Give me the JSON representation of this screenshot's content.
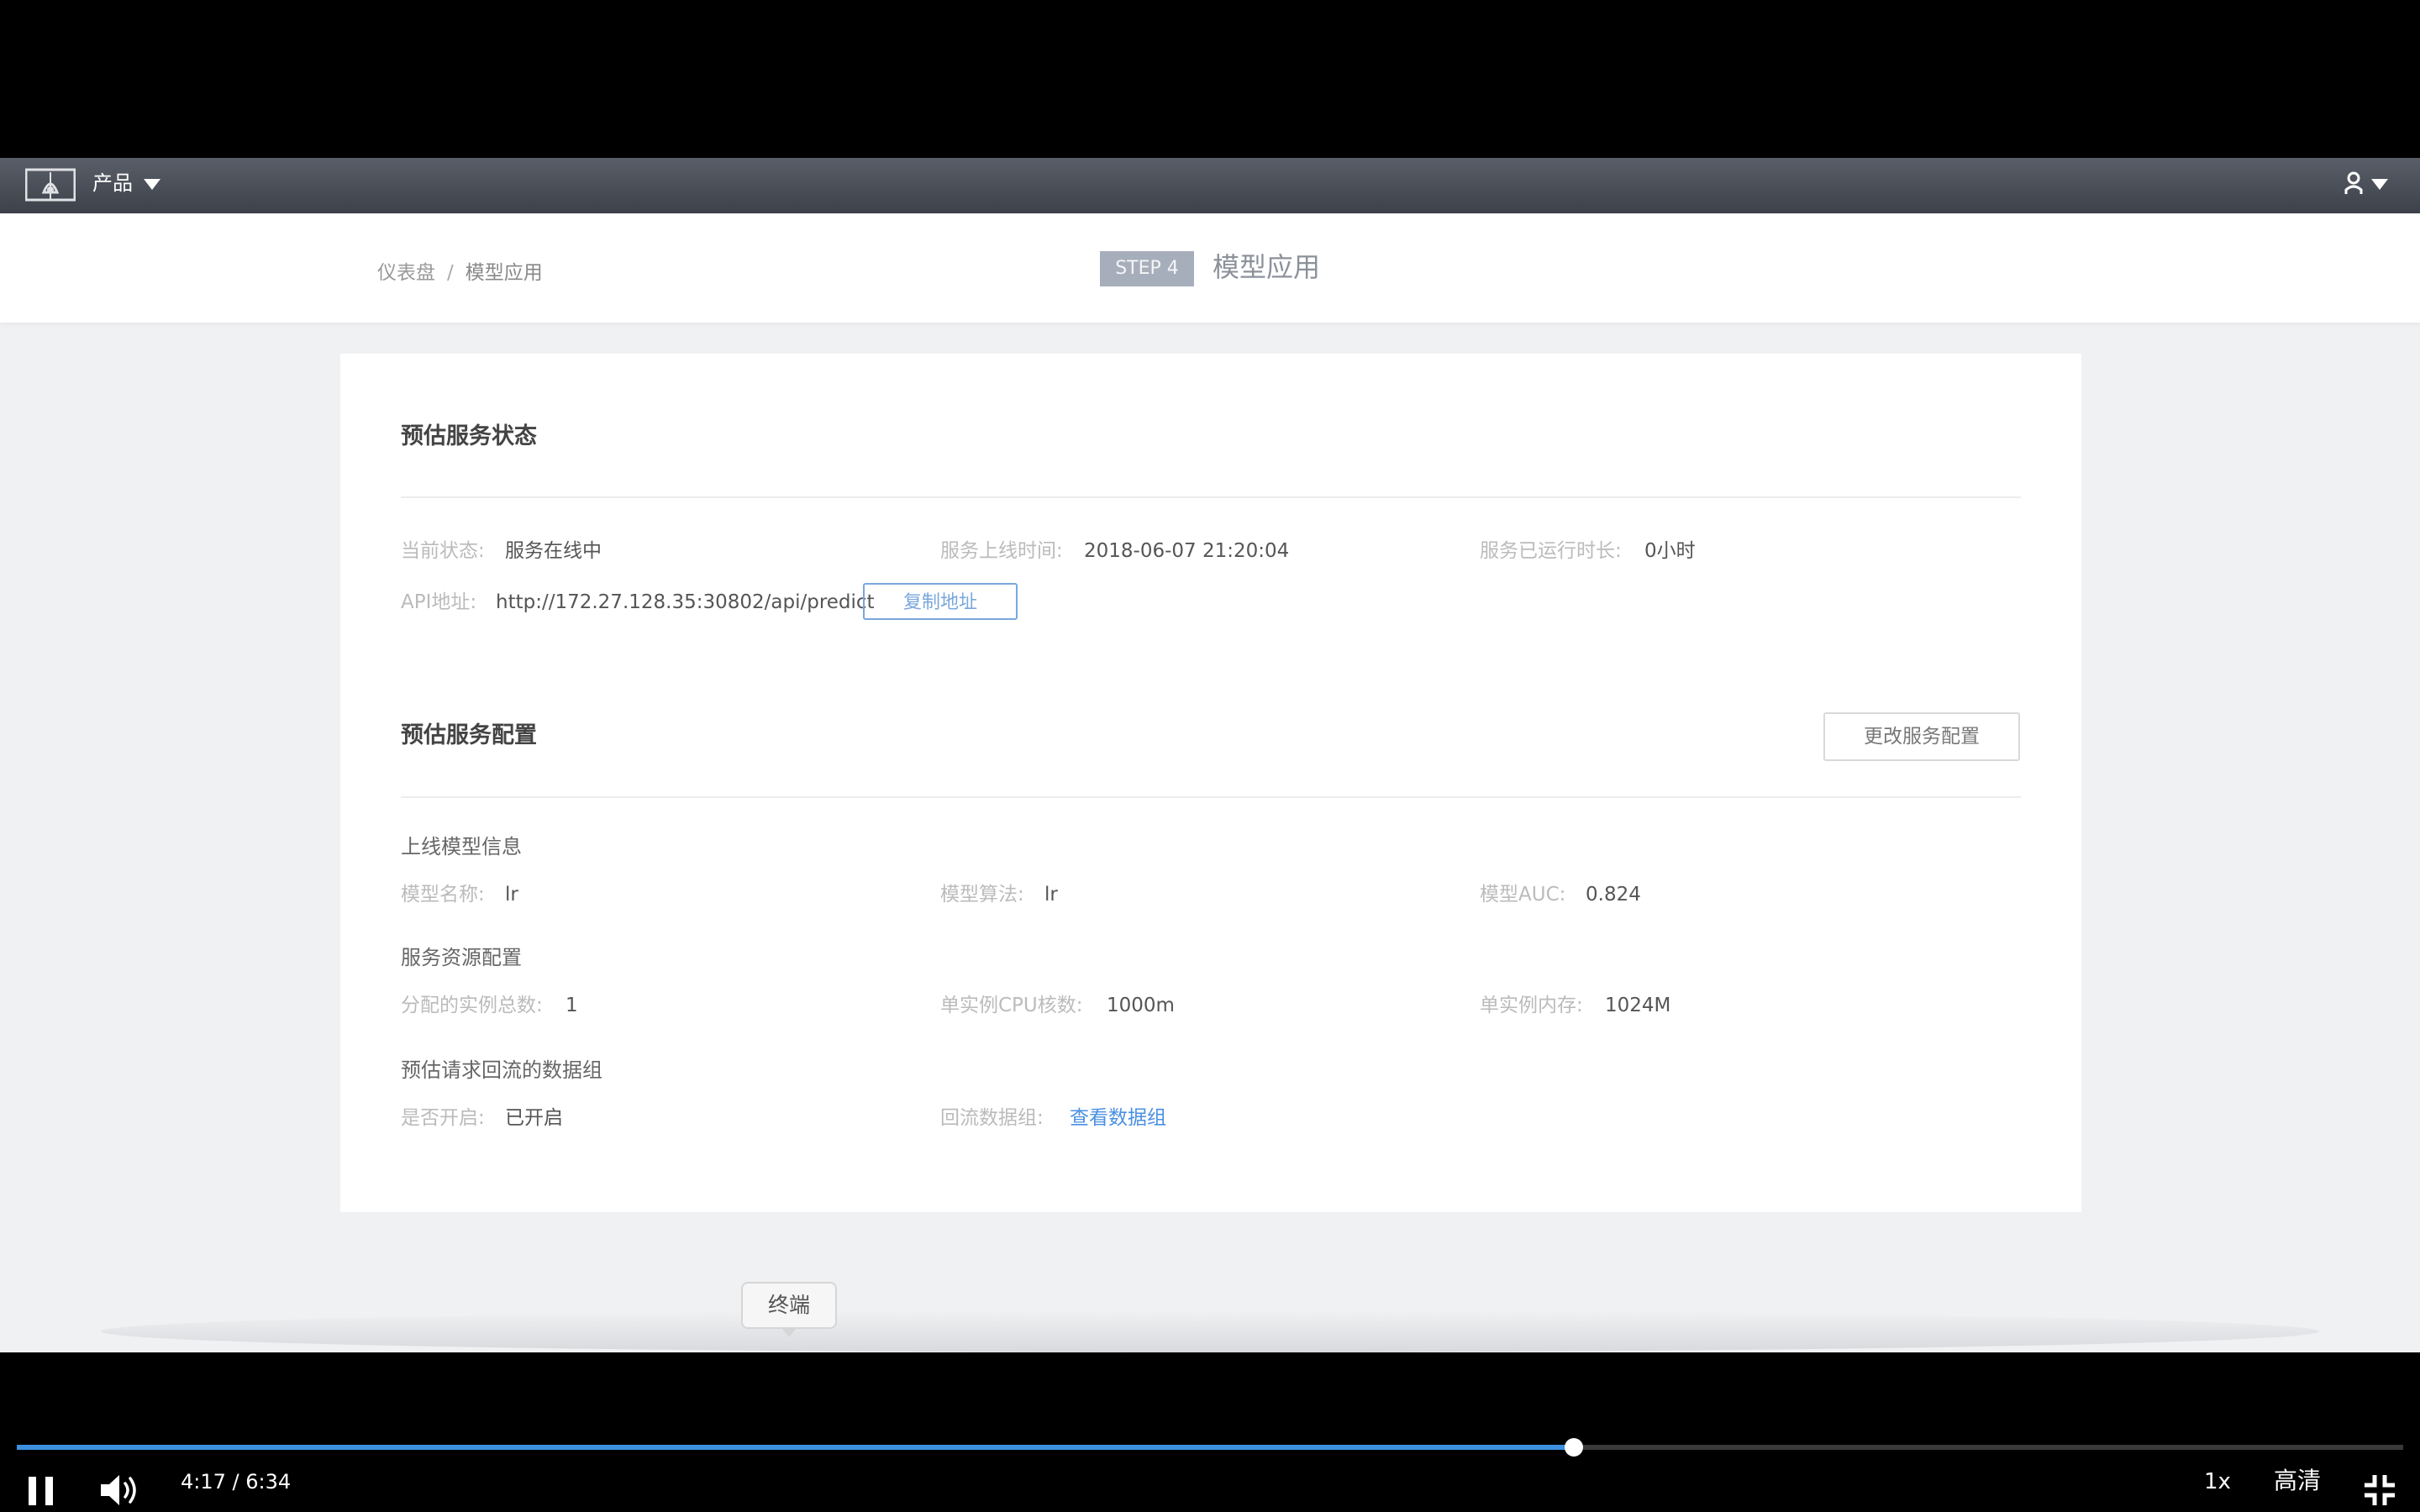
{
  "nav": {
    "product_label": "产品"
  },
  "breadcrumb": {
    "root": "仪表盘",
    "separator": "/",
    "current": "模型应用"
  },
  "step": {
    "badge": "STEP 4",
    "title": "模型应用"
  },
  "status_section": {
    "title": "预估服务状态",
    "current_status_label": "当前状态:",
    "current_status_value": "服务在线中",
    "online_time_label": "服务上线时间:",
    "online_time_value": "2018-06-07 21:20:04",
    "runtime_label": "服务已运行时长:",
    "runtime_value": "0小时",
    "api_label": "API地址:",
    "api_value": "http://172.27.128.35:30802/api/predict",
    "copy_button": "复制地址"
  },
  "config_section": {
    "title": "预估服务配置",
    "change_button": "更改服务配置",
    "model_info": {
      "title": "上线模型信息",
      "name_label": "模型名称:",
      "name_value": "lr",
      "algo_label": "模型算法:",
      "algo_value": "lr",
      "auc_label": "模型AUC:",
      "auc_value": "0.824"
    },
    "resources": {
      "title": "服务资源配置",
      "instances_label": "分配的实例总数:",
      "instances_value": "1",
      "cpu_label": "单实例CPU核数:",
      "cpu_value": "1000m",
      "memory_label": "单实例内存:",
      "memory_value": "1024M"
    },
    "feedback": {
      "title": "预估请求回流的数据组",
      "enabled_label": "是否开启:",
      "enabled_value": "已开启",
      "group_label": "回流数据组:",
      "group_link": "查看数据组"
    }
  },
  "tooltip": {
    "text": "终端"
  },
  "player": {
    "current_time": "4:17",
    "total_time": "6:34",
    "time_separator": " / ",
    "progress_fraction": 0.6523,
    "speed": "1x",
    "quality": "高清",
    "accent_color": "#3d8fe0"
  }
}
